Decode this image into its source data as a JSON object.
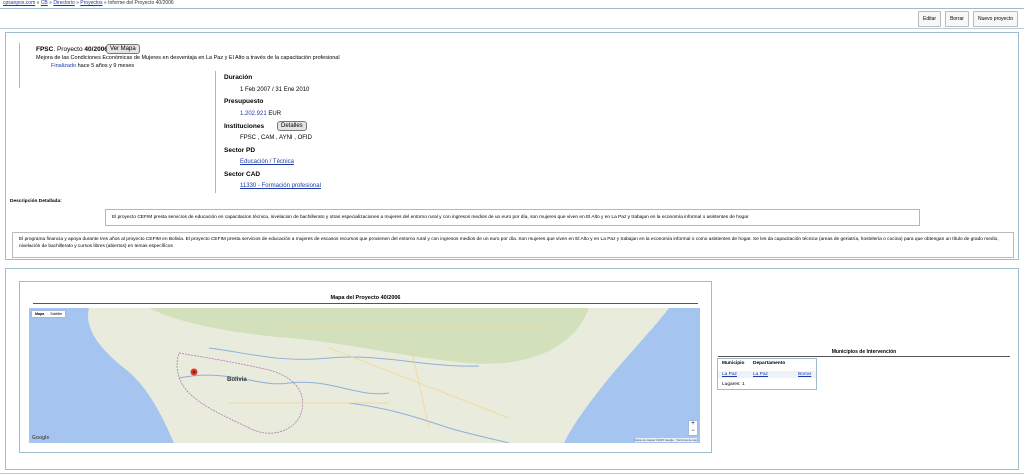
{
  "breadcrumb": {
    "items": [
      "cpsanpox.com",
      "CB",
      "Directorio",
      "Proyectos"
    ],
    "current": "Informe del Proyecto 40/2006"
  },
  "toolbar": {
    "edit": "Editar",
    "delete": "Borrar",
    "new_project": "Nuevo proyecto"
  },
  "project": {
    "org": "FPSC",
    "project_prefix": ". Proyecto ",
    "project_id": "40/2006",
    "map_button": "Ver Mapa",
    "short_description": "Mejora de las Condiciones Económicas de Mujeres en desventaja en La Paz y El Alto a través de la capacitación profesional",
    "status": "Finalizado",
    "status_age": "hace 5 años y 9 meses"
  },
  "details": {
    "duration_label": "Duración",
    "duration": "1 Feb 2007 / 31 Ene 2010",
    "budget_label": "Presupuesto",
    "budget_amount": "1.202.921",
    "budget_currency": "EUR",
    "institutions_label": "Instituciones",
    "institutions_button": "Detalles",
    "institutions": "FPSC , CAM , AYNI , OFID",
    "sector_pd_label": "Sector PD",
    "sector_pd": "Educación / Técnica",
    "sector_cad_label": "Sector CAD",
    "sector_cad": "11330 - Formación profesional"
  },
  "description": {
    "label": "Descripción Detallada:",
    "summary": "El proyecto CEFIM presta servicios de educación en capacitacion técnica, nivelacion de bachillerato y otras especializaciones a mujeres del entorno rural y con ingresos medios de un euro por día, son mujeres que viven en El Alto y en La Paz y trabajan en la economía informal o asistentes de hogar",
    "full": "El programa financia y apoya durante tres años al proyecto CEFIM en Bolivia. El proyecto CEFIM presta servicios de educación a mujeres de escasos recursos que provienen del entorno rural y con ingresos medios de un euro por día. Son mujeres que viven en El Alto y en La Paz y trabajan en la economía informal o como asistentes de hogar. Se les da capacitación técnica (areas de geriatría, hostelería o cocina) para que obtengan un título de grado medio, nivelación de bachillerato y cursos libres (abiertos) en temas específicos"
  },
  "map": {
    "title": "Mapa del Proyecto 40/2006",
    "tab_map": "Mapa",
    "tab_satellite": "Satélite",
    "country_label": "Bolivia",
    "zoom_in": "+",
    "zoom_out": "−",
    "google": "Google",
    "attribution": "Datos de mapas ©2015 Google · Términos de uso"
  },
  "municipios": {
    "title": "Municipios de Intervención",
    "col_municipio": "Municipio",
    "col_departamento": "Departamento",
    "rows": [
      {
        "municipio": "La Paz",
        "departamento": "La Paz",
        "action": "Borrar"
      }
    ],
    "lugares": "Lugares: 1"
  },
  "colors": {
    "accent": "#1a3ca8",
    "panel_border": "#9fbccc",
    "ocean": "#a6c4f0",
    "marker": "#d93a2c"
  },
  "icons": [
    "map-marker-icon",
    "zoom-in-icon",
    "zoom-out-icon"
  ]
}
